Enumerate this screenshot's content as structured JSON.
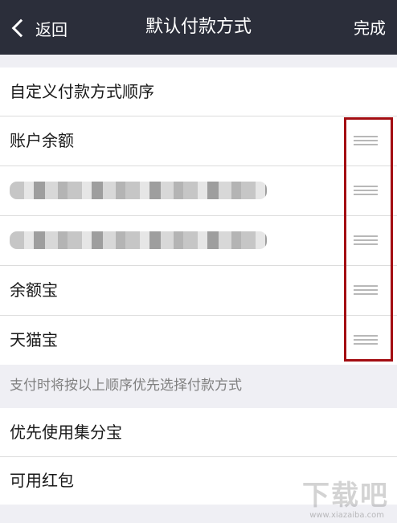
{
  "header": {
    "back_label": "返回",
    "title": "默认付款方式",
    "done_label": "完成"
  },
  "payment_order": {
    "section_title": "自定义付款方式顺序",
    "items": [
      {
        "label": "账户余额",
        "blurred": false
      },
      {
        "label": "",
        "blurred": true
      },
      {
        "label": "",
        "blurred": true
      },
      {
        "label": "余额宝",
        "blurred": false
      },
      {
        "label": "天猫宝",
        "blurred": false
      }
    ],
    "highlight_color": "#a30d12"
  },
  "note": "支付时将按以上顺序优先选择付款方式",
  "options": {
    "items": [
      {
        "label": "优先使用集分宝"
      },
      {
        "label": "可用红包"
      }
    ]
  },
  "watermark": {
    "text": "下载吧",
    "url": "www.xiazaiba.com"
  },
  "icons": {
    "back": "chevron-left-icon",
    "drag": "drag-handle-icon"
  },
  "colors": {
    "navbar": "#2b2e3a",
    "background": "#efeff4",
    "annotation": "#a30d12"
  }
}
